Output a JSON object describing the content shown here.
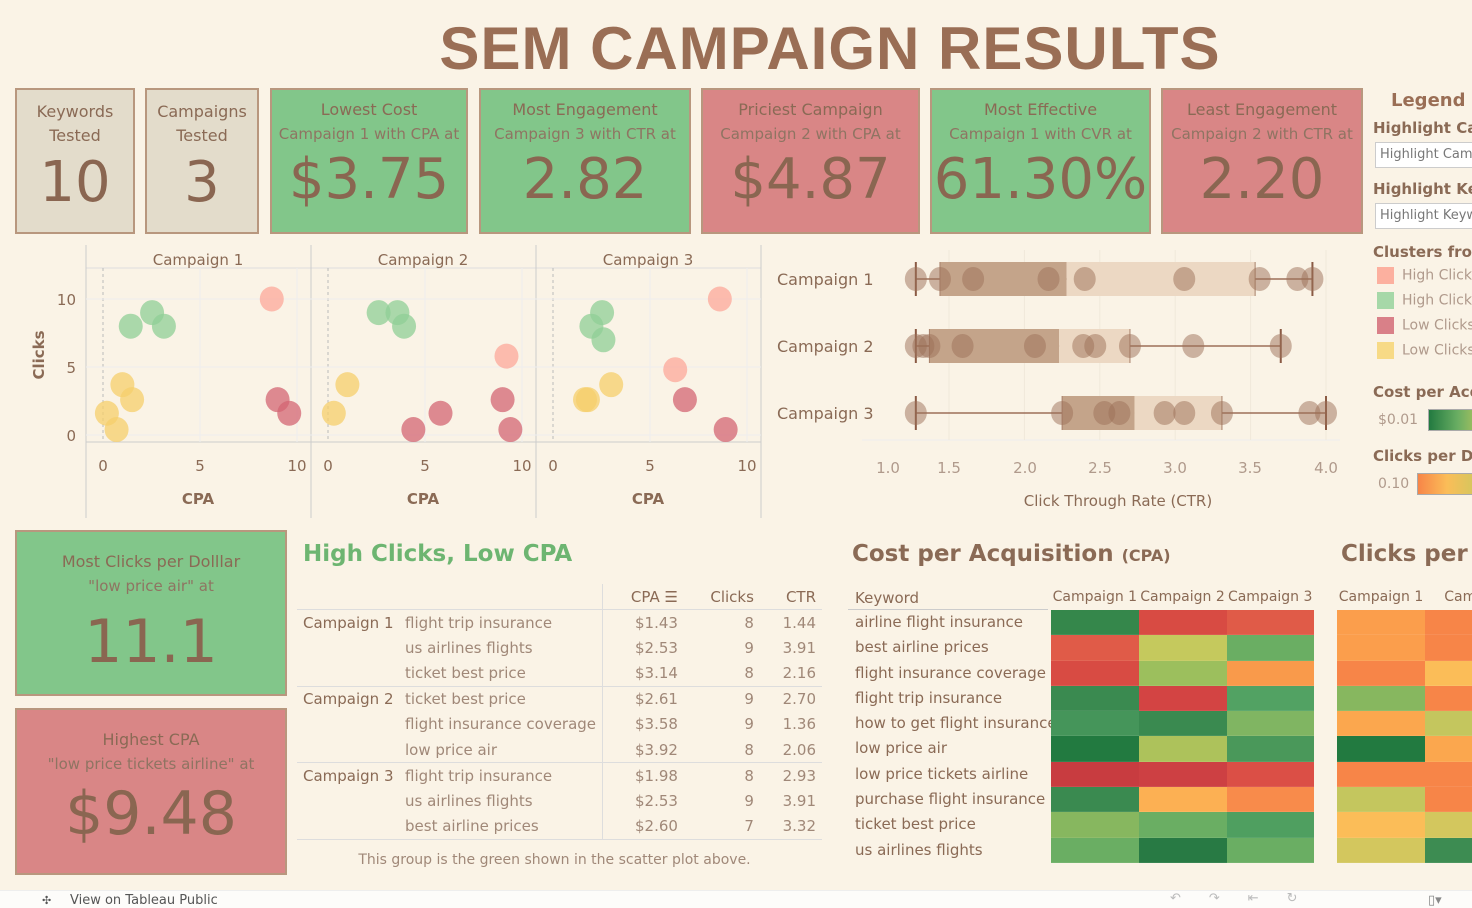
{
  "title": "SEM CAMPAIGN RESULTS",
  "kpis": [
    {
      "title": "Keywords Tested",
      "subtitle": "",
      "value": "10",
      "color": "#e3dccb"
    },
    {
      "title": "Campaigns Tested",
      "subtitle": "",
      "value": "3",
      "color": "#e3dccb"
    },
    {
      "title": "Lowest Cost",
      "subtitle": "Campaign 1 with CPA at",
      "value": "$3.75",
      "color": "#82c68a"
    },
    {
      "title": "Most Engagement",
      "subtitle": "Campaign 3 with CTR at",
      "value": "2.82",
      "color": "#82c68a"
    },
    {
      "title": "Priciest Campaign",
      "subtitle": "Campaign 2 with CPA at",
      "value": "$4.87",
      "color": "#d98686"
    },
    {
      "title": "Most Effective",
      "subtitle": "Campaign 1 with CVR at",
      "value": "61.30%",
      "color": "#82c68a"
    },
    {
      "title": "Least Engagement",
      "subtitle": "Campaign 2 with CTR at",
      "value": "2.20",
      "color": "#d98686"
    }
  ],
  "tiles": [
    {
      "title": "Most Clicks per Dolllar",
      "subtitle": "\"low price air\" at",
      "value": "11.1"
    },
    {
      "title": "Highest CPA",
      "subtitle": "\"low price tickets airline\" at",
      "value": "$9.48"
    }
  ],
  "legend": {
    "title": "Legend a",
    "highlight_campaign_label": "Highlight Ca",
    "highlight_campaign_placeholder": "Highlight Camp",
    "highlight_keyword_label": "Highlight Ke",
    "highlight_keyword_placeholder": "Highlight Keyw",
    "clusters_title": "Clusters fror",
    "clusters": [
      {
        "label": "High Click",
        "color": "#fcb09f"
      },
      {
        "label": "High Click",
        "color": "#a6d8a8"
      },
      {
        "label": "Low Clicks",
        "color": "#d98088"
      },
      {
        "label": "Low Clicks",
        "color": "#f7da86"
      }
    ],
    "cpa_title": "Cost per Acq",
    "cpa_min": "$0.01",
    "cpd_title": "Clicks per Do",
    "cpd_min": "0.10"
  },
  "chart_data": [
    {
      "type": "scatter",
      "panels": [
        "Campaign 1",
        "Campaign 2",
        "Campaign 3"
      ],
      "xlabel": "CPA",
      "ylabel": "Clicks",
      "xticks": [
        "0",
        "5",
        "10"
      ],
      "yticks": [
        "0",
        "5",
        "10"
      ],
      "xlim": [
        0,
        10
      ],
      "ylim": [
        0,
        10
      ],
      "cluster_colors": {
        "high_clicks_high_cpa": "#fca89a",
        "high_clicks_low_cpa": "#8fcf96",
        "low_clicks_high_cpa": "#d36573",
        "low_clicks_low_cpa": "#f5cf6b"
      },
      "points": [
        {
          "panel": 0,
          "x": 8.7,
          "y": 10,
          "c": "high_clicks_high_cpa"
        },
        {
          "panel": 0,
          "x": 1.43,
          "y": 8,
          "c": "high_clicks_low_cpa"
        },
        {
          "panel": 0,
          "x": 2.53,
          "y": 9,
          "c": "high_clicks_low_cpa"
        },
        {
          "panel": 0,
          "x": 3.14,
          "y": 8,
          "c": "high_clicks_low_cpa"
        },
        {
          "panel": 0,
          "x": 1.0,
          "y": 3.7,
          "c": "low_clicks_low_cpa"
        },
        {
          "panel": 0,
          "x": 1.5,
          "y": 2.6,
          "c": "low_clicks_low_cpa"
        },
        {
          "panel": 0,
          "x": 0.2,
          "y": 1.6,
          "c": "low_clicks_low_cpa"
        },
        {
          "panel": 0,
          "x": 0.7,
          "y": 0.4,
          "c": "low_clicks_low_cpa"
        },
        {
          "panel": 0,
          "x": 9.0,
          "y": 2.6,
          "c": "low_clicks_high_cpa"
        },
        {
          "panel": 0,
          "x": 9.6,
          "y": 1.6,
          "c": "low_clicks_high_cpa"
        },
        {
          "panel": 1,
          "x": 2.61,
          "y": 9,
          "c": "high_clicks_low_cpa"
        },
        {
          "panel": 1,
          "x": 3.58,
          "y": 9,
          "c": "high_clicks_low_cpa"
        },
        {
          "panel": 1,
          "x": 3.92,
          "y": 8,
          "c": "high_clicks_low_cpa"
        },
        {
          "panel": 1,
          "x": 9.2,
          "y": 5.8,
          "c": "high_clicks_high_cpa"
        },
        {
          "panel": 1,
          "x": 1.0,
          "y": 3.7,
          "c": "low_clicks_low_cpa"
        },
        {
          "panel": 1,
          "x": 0.3,
          "y": 1.6,
          "c": "low_clicks_low_cpa"
        },
        {
          "panel": 1,
          "x": 9.0,
          "y": 2.6,
          "c": "low_clicks_high_cpa"
        },
        {
          "panel": 1,
          "x": 5.8,
          "y": 1.6,
          "c": "low_clicks_high_cpa"
        },
        {
          "panel": 1,
          "x": 4.4,
          "y": 0.4,
          "c": "low_clicks_high_cpa"
        },
        {
          "panel": 1,
          "x": 9.4,
          "y": 0.4,
          "c": "low_clicks_high_cpa"
        },
        {
          "panel": 2,
          "x": 2.53,
          "y": 9,
          "c": "high_clicks_low_cpa"
        },
        {
          "panel": 2,
          "x": 1.98,
          "y": 8,
          "c": "high_clicks_low_cpa"
        },
        {
          "panel": 2,
          "x": 2.6,
          "y": 7,
          "c": "high_clicks_low_cpa"
        },
        {
          "panel": 2,
          "x": 8.6,
          "y": 10,
          "c": "high_clicks_high_cpa"
        },
        {
          "panel": 2,
          "x": 6.3,
          "y": 4.8,
          "c": "high_clicks_high_cpa"
        },
        {
          "panel": 2,
          "x": 3.0,
          "y": 3.7,
          "c": "low_clicks_low_cpa"
        },
        {
          "panel": 2,
          "x": 1.65,
          "y": 2.6,
          "c": "low_clicks_low_cpa"
        },
        {
          "panel": 2,
          "x": 1.8,
          "y": 2.6,
          "c": "low_clicks_low_cpa"
        },
        {
          "panel": 2,
          "x": 6.8,
          "y": 2.6,
          "c": "low_clicks_high_cpa"
        },
        {
          "panel": 2,
          "x": 8.9,
          "y": 0.4,
          "c": "low_clicks_high_cpa"
        }
      ]
    },
    {
      "type": "box",
      "xlabel": "Click Through Rate (CTR)",
      "xticks": [
        "1.0",
        "1.5",
        "2.0",
        "2.5",
        "3.0",
        "3.5",
        "4.0"
      ],
      "series": [
        {
          "name": "Campaign 1",
          "whisker": [
            1.28,
            3.91
          ],
          "q1": 1.44,
          "median": 2.28,
          "q3": 3.53,
          "points": [
            1.28,
            1.44,
            1.66,
            2.16,
            2.4,
            3.06,
            3.56,
            3.81,
            3.91
          ]
        },
        {
          "name": "Campaign 2",
          "whisker": [
            1.28,
            3.7
          ],
          "q1": 1.37,
          "median": 2.23,
          "q3": 2.7,
          "points": [
            1.28,
            1.33,
            1.37,
            1.59,
            2.07,
            2.39,
            2.47,
            2.7,
            3.12,
            3.7
          ]
        },
        {
          "name": "Campaign 3",
          "whisker": [
            1.28,
            4.0
          ],
          "q1": 2.25,
          "median": 2.73,
          "q3": 3.31,
          "points": [
            1.28,
            2.25,
            2.53,
            2.63,
            2.93,
            3.06,
            3.31,
            3.89,
            4.0
          ]
        }
      ]
    }
  ],
  "top_table": {
    "title": "High Clicks, Low CPA",
    "headers": [
      "CPA",
      "Clicks",
      "CTR"
    ],
    "groups": [
      {
        "campaign": "Campaign 1",
        "rows": [
          [
            "flight trip insurance",
            "$1.43",
            "8",
            "1.44"
          ],
          [
            "us airlines flights",
            "$2.53",
            "9",
            "3.91"
          ],
          [
            "ticket best price",
            "$3.14",
            "8",
            "2.16"
          ]
        ]
      },
      {
        "campaign": "Campaign 2",
        "rows": [
          [
            "ticket best price",
            "$2.61",
            "9",
            "2.70"
          ],
          [
            "flight insurance coverage",
            "$3.58",
            "9",
            "1.36"
          ],
          [
            "low price air",
            "$3.92",
            "8",
            "2.06"
          ]
        ]
      },
      {
        "campaign": "Campaign 3",
        "rows": [
          [
            "flight trip insurance",
            "$1.98",
            "8",
            "2.93"
          ],
          [
            "us airlines flights",
            "$2.53",
            "9",
            "3.91"
          ],
          [
            "best airline prices",
            "$2.60",
            "7",
            "3.32"
          ]
        ]
      }
    ],
    "note": "This group is the green shown in the scatter plot above."
  },
  "cpa_heatmap": {
    "title": "Cost per Acquisition",
    "title_suffix": "(CPA)",
    "keyword_header": "Keyword",
    "columns": [
      "Campaign 1",
      "Campaign 2",
      "Campaign 3"
    ],
    "keywords": [
      "airline flight insurance",
      "best airline prices",
      "flight insurance coverage",
      "flight trip insurance",
      "how to get flight insurance",
      "low price air",
      "low price tickets airline",
      "purchase flight insurance",
      "ticket best price",
      "us airlines flights"
    ],
    "colors": [
      [
        "#35874b",
        "#d84b43",
        "#e05b48"
      ],
      [
        "#e05b48",
        "#c5c95d",
        "#6aae63"
      ],
      [
        "#d84b43",
        "#9cbf5d",
        "#f99a4b"
      ],
      [
        "#3a8a50",
        "#d34443",
        "#52a263"
      ],
      [
        "#45955a",
        "#3a8a50",
        "#80b562"
      ],
      [
        "#227a40",
        "#adc25b",
        "#4a985a"
      ],
      [
        "#c83c40",
        "#cd4043",
        "#db4f46"
      ],
      [
        "#3a8a50",
        "#fcb053",
        "#f88b4b"
      ],
      [
        "#87b75f",
        "#6aae63",
        "#4f9f60"
      ],
      [
        "#6aae63",
        "#287a44",
        "#6aae63"
      ]
    ]
  },
  "cpd_heatmap": {
    "title": "Clicks per D",
    "columns": [
      "Campaign 1",
      "Campa"
    ],
    "colors": [
      [
        "#fb9e4c",
        "#f78548"
      ],
      [
        "#fb9e4c",
        "#f78548"
      ],
      [
        "#f78548",
        "#fbbd58"
      ],
      [
        "#87b75f",
        "#f78548"
      ],
      [
        "#fba74e",
        "#c4c65e"
      ],
      [
        "#227a40",
        "#fba74e"
      ],
      [
        "#f78548",
        "#f78548"
      ],
      [
        "#c4c65e",
        "#f78548"
      ],
      [
        "#fbbd58",
        "#d3c75e"
      ],
      [
        "#d3c75e",
        "#3d8c52"
      ]
    ]
  },
  "footer": {
    "link": "View on Tableau Public"
  }
}
